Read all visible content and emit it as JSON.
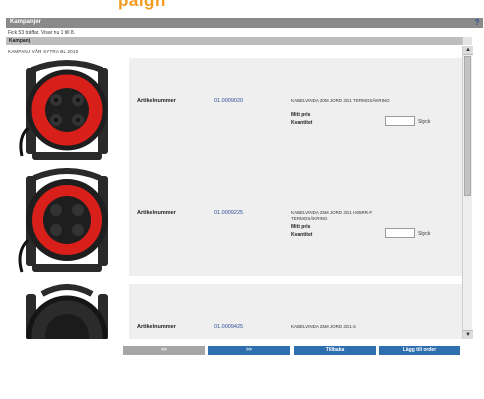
{
  "page": {
    "heading": "paign",
    "title_bar": "Kampanjer",
    "help_icon": "?",
    "hits_text": "Fick 53 träffar. Visar nu 1 till 8.",
    "section_title": "Kampanj",
    "campaign_name": "KAMPANJ VÅR SYTRA BL 2010"
  },
  "products": [
    {
      "article_label": "Artikelnummer",
      "article_number": "01.0009020",
      "description": "KABELVINDA 20M JORD 3G1 TERMOSÄKRING",
      "price_label": "Mitt pris",
      "quantity_label": "Kvantitet",
      "quantity_value": "",
      "unit": "Styck"
    },
    {
      "article_label": "Artikelnummer",
      "article_number": "01.0009225",
      "description": "KABELVINDA 25M JORD 3G1 H05RR-F TERMOSÄKRING",
      "price_label": "Mitt pris",
      "quantity_label": "Kvantitet",
      "quantity_value": "",
      "unit": "Styck"
    },
    {
      "article_label": "Artikelnummer",
      "article_number": "01.0009425",
      "description": "KABELVINDA 25M JORD 3G1.5",
      "price_label": "",
      "quantity_label": "",
      "quantity_value": "",
      "unit": ""
    }
  ],
  "buttons": {
    "prev": "<<",
    "next": ">>",
    "back": "Tillbaka",
    "add_to_order": "Lägg till order"
  },
  "colors": {
    "heading": "#f39a1f",
    "title_bar": "#8a8a8a",
    "link": "#2e4f9a",
    "button": "#2f6fb0",
    "button_disabled": "#a6a6a6",
    "reel_red": "#e0211b",
    "reel_black": "#2a2a2a"
  },
  "scrollbar": {
    "up": "▲",
    "down": "▼"
  }
}
